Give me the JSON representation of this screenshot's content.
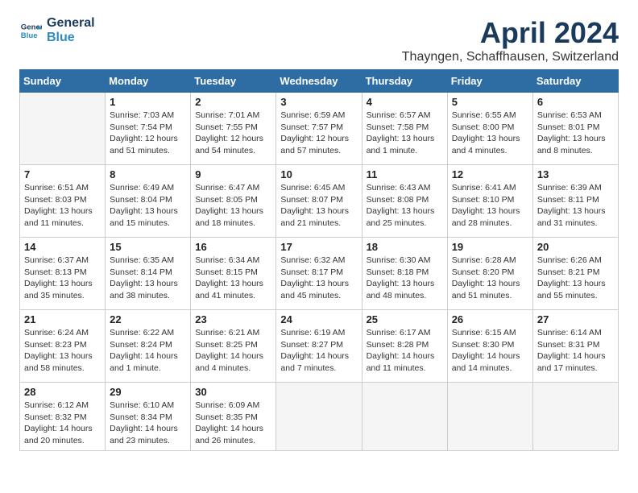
{
  "logo": {
    "line1": "General",
    "line2": "Blue"
  },
  "title": "April 2024",
  "location": "Thayngen, Schaffhausen, Switzerland",
  "weekdays": [
    "Sunday",
    "Monday",
    "Tuesday",
    "Wednesday",
    "Thursday",
    "Friday",
    "Saturday"
  ],
  "weeks": [
    [
      {
        "day": "",
        "sunrise": "",
        "sunset": "",
        "daylight": ""
      },
      {
        "day": "1",
        "sunrise": "7:03 AM",
        "sunset": "7:54 PM",
        "daylight": "12 hours and 51 minutes."
      },
      {
        "day": "2",
        "sunrise": "7:01 AM",
        "sunset": "7:55 PM",
        "daylight": "12 hours and 54 minutes."
      },
      {
        "day": "3",
        "sunrise": "6:59 AM",
        "sunset": "7:57 PM",
        "daylight": "12 hours and 57 minutes."
      },
      {
        "day": "4",
        "sunrise": "6:57 AM",
        "sunset": "7:58 PM",
        "daylight": "13 hours and 1 minute."
      },
      {
        "day": "5",
        "sunrise": "6:55 AM",
        "sunset": "8:00 PM",
        "daylight": "13 hours and 4 minutes."
      },
      {
        "day": "6",
        "sunrise": "6:53 AM",
        "sunset": "8:01 PM",
        "daylight": "13 hours and 8 minutes."
      }
    ],
    [
      {
        "day": "7",
        "sunrise": "6:51 AM",
        "sunset": "8:03 PM",
        "daylight": "13 hours and 11 minutes."
      },
      {
        "day": "8",
        "sunrise": "6:49 AM",
        "sunset": "8:04 PM",
        "daylight": "13 hours and 15 minutes."
      },
      {
        "day": "9",
        "sunrise": "6:47 AM",
        "sunset": "8:05 PM",
        "daylight": "13 hours and 18 minutes."
      },
      {
        "day": "10",
        "sunrise": "6:45 AM",
        "sunset": "8:07 PM",
        "daylight": "13 hours and 21 minutes."
      },
      {
        "day": "11",
        "sunrise": "6:43 AM",
        "sunset": "8:08 PM",
        "daylight": "13 hours and 25 minutes."
      },
      {
        "day": "12",
        "sunrise": "6:41 AM",
        "sunset": "8:10 PM",
        "daylight": "13 hours and 28 minutes."
      },
      {
        "day": "13",
        "sunrise": "6:39 AM",
        "sunset": "8:11 PM",
        "daylight": "13 hours and 31 minutes."
      }
    ],
    [
      {
        "day": "14",
        "sunrise": "6:37 AM",
        "sunset": "8:13 PM",
        "daylight": "13 hours and 35 minutes."
      },
      {
        "day": "15",
        "sunrise": "6:35 AM",
        "sunset": "8:14 PM",
        "daylight": "13 hours and 38 minutes."
      },
      {
        "day": "16",
        "sunrise": "6:34 AM",
        "sunset": "8:15 PM",
        "daylight": "13 hours and 41 minutes."
      },
      {
        "day": "17",
        "sunrise": "6:32 AM",
        "sunset": "8:17 PM",
        "daylight": "13 hours and 45 minutes."
      },
      {
        "day": "18",
        "sunrise": "6:30 AM",
        "sunset": "8:18 PM",
        "daylight": "13 hours and 48 minutes."
      },
      {
        "day": "19",
        "sunrise": "6:28 AM",
        "sunset": "8:20 PM",
        "daylight": "13 hours and 51 minutes."
      },
      {
        "day": "20",
        "sunrise": "6:26 AM",
        "sunset": "8:21 PM",
        "daylight": "13 hours and 55 minutes."
      }
    ],
    [
      {
        "day": "21",
        "sunrise": "6:24 AM",
        "sunset": "8:23 PM",
        "daylight": "13 hours and 58 minutes."
      },
      {
        "day": "22",
        "sunrise": "6:22 AM",
        "sunset": "8:24 PM",
        "daylight": "14 hours and 1 minute."
      },
      {
        "day": "23",
        "sunrise": "6:21 AM",
        "sunset": "8:25 PM",
        "daylight": "14 hours and 4 minutes."
      },
      {
        "day": "24",
        "sunrise": "6:19 AM",
        "sunset": "8:27 PM",
        "daylight": "14 hours and 7 minutes."
      },
      {
        "day": "25",
        "sunrise": "6:17 AM",
        "sunset": "8:28 PM",
        "daylight": "14 hours and 11 minutes."
      },
      {
        "day": "26",
        "sunrise": "6:15 AM",
        "sunset": "8:30 PM",
        "daylight": "14 hours and 14 minutes."
      },
      {
        "day": "27",
        "sunrise": "6:14 AM",
        "sunset": "8:31 PM",
        "daylight": "14 hours and 17 minutes."
      }
    ],
    [
      {
        "day": "28",
        "sunrise": "6:12 AM",
        "sunset": "8:32 PM",
        "daylight": "14 hours and 20 minutes."
      },
      {
        "day": "29",
        "sunrise": "6:10 AM",
        "sunset": "8:34 PM",
        "daylight": "14 hours and 23 minutes."
      },
      {
        "day": "30",
        "sunrise": "6:09 AM",
        "sunset": "8:35 PM",
        "daylight": "14 hours and 26 minutes."
      },
      {
        "day": "",
        "sunrise": "",
        "sunset": "",
        "daylight": ""
      },
      {
        "day": "",
        "sunrise": "",
        "sunset": "",
        "daylight": ""
      },
      {
        "day": "",
        "sunrise": "",
        "sunset": "",
        "daylight": ""
      },
      {
        "day": "",
        "sunrise": "",
        "sunset": "",
        "daylight": ""
      }
    ]
  ],
  "labels": {
    "sunrise_prefix": "Sunrise: ",
    "sunset_prefix": "Sunset: ",
    "daylight_prefix": "Daylight: "
  }
}
